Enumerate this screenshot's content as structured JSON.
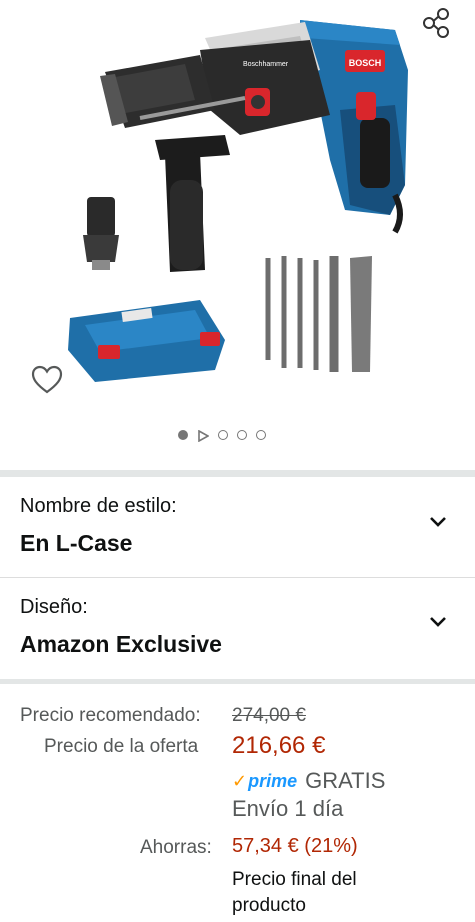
{
  "gallery": {
    "share_icon": "share-icon",
    "wishlist_icon": "heart-outline-icon",
    "image_count": 5,
    "current_image": 1,
    "has_video": true,
    "product_brand_mark": "BOSCH",
    "tool_label": "Boschhammer"
  },
  "variations": [
    {
      "label": "Nombre de estilo:",
      "value": "En L-Case"
    },
    {
      "label": "Diseño:",
      "value": "Amazon Exclusive"
    }
  ],
  "price": {
    "list_label": "Precio recomendado:",
    "list_value": "274,00 €",
    "offer_label": "Precio de la oferta",
    "offer_value": "216,66 €",
    "prime_text": "prime",
    "shipping_free": "GRATIS",
    "delivery": "Envío 1 día",
    "savings_label": "Ahorras:",
    "savings_value": "57,34 € (21%)",
    "final_note": "Precio final del producto"
  },
  "colors": {
    "price_red": "#b12704",
    "prime_blue": "#1a98ff",
    "prime_check": "#ff9900",
    "divider": "#e3e6e6",
    "bosch_blue": "#1f6fa8"
  }
}
